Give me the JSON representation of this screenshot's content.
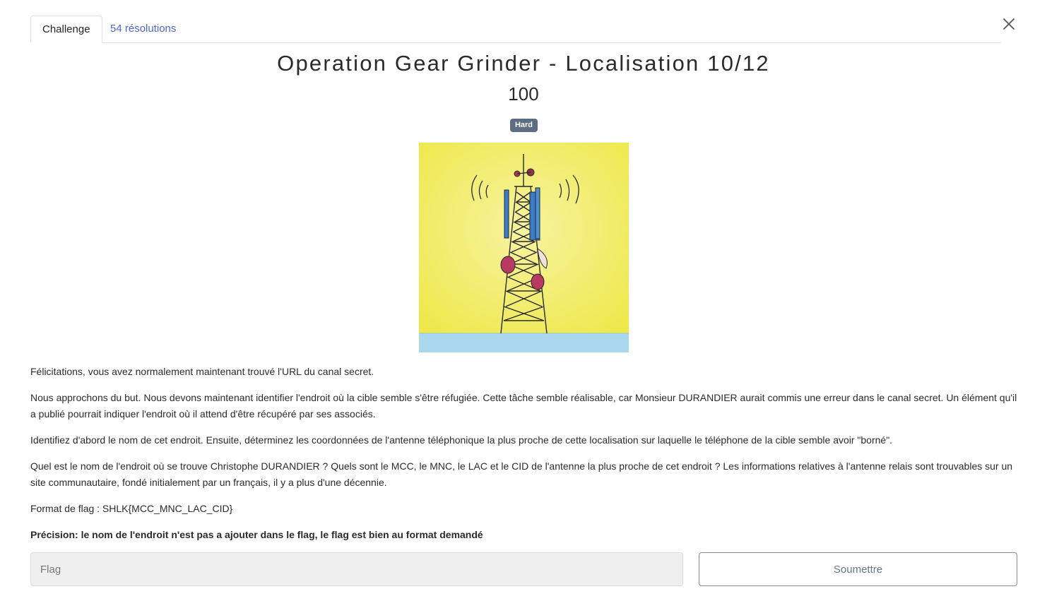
{
  "tabs": [
    {
      "label": "Challenge"
    },
    {
      "label": "54 résolutions"
    }
  ],
  "challenge": {
    "title": "Operation Gear Grinder - Localisation 10/12",
    "points": "100",
    "difficulty": "Hard"
  },
  "description": {
    "p1": "Félicitations, vous avez normalement maintenant trouvé l'URL du canal secret.",
    "p2": "Nous approchons du but. Nous devons maintenant identifier l'endroit où la cible semble s'être réfugiée. Cette tâche semble réalisable, car Monsieur DURANDIER aurait commis une erreur dans le canal secret. Un élément qu'il a publié pourrait indiquer l'endroit où il attend d'être récupéré par ses associés.",
    "p3": "Identifiez d'abord le nom de cet endroit. Ensuite, déterminez les coordonnées de l'antenne téléphonique la plus proche de cette localisation sur laquelle le téléphone de la cible semble avoir \"borné\".",
    "p4": "Quel est le nom de l'endroit où se trouve Christophe DURANDIER ? Quels sont le MCC, le MNC, le LAC et le CID de l'antenne la plus proche de cet endroit ? Les informations relatives à l'antenne relais sont trouvables sur un site communautaire, fondé initialement par un français, il y a plus d'une décennie.",
    "p5": "Format de flag : SHLK{MCC_MNC_LAC_CID}",
    "p6": "Précision: le nom de l'endroit n'est pas a ajouter dans le flag, le flag est bien au format demandé"
  },
  "form": {
    "flag_placeholder": "Flag",
    "flag_value": "",
    "submit_label": "Soumettre"
  },
  "icons": {
    "close": "close-icon",
    "picture": "cell-tower-illustration"
  },
  "colors": {
    "link": "#4a66d6",
    "badge": "#5d6e83",
    "picture_sky": "#f3ee5c",
    "picture_water": "#a9d8ee"
  }
}
